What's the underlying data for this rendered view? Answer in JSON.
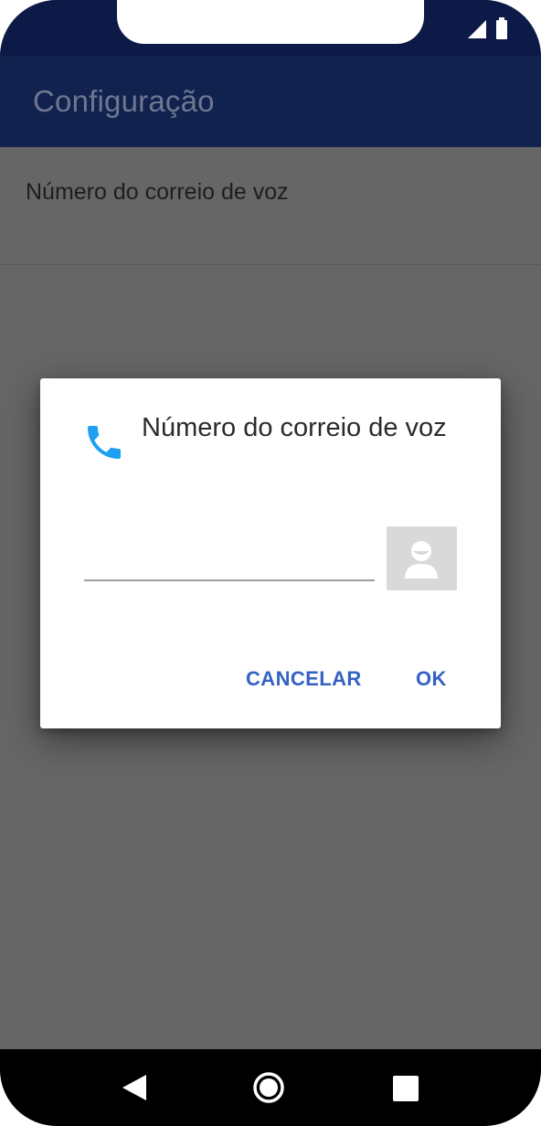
{
  "app_bar": {
    "title": "Configuração"
  },
  "preferences": {
    "items": [
      {
        "label": "Número do correio de voz"
      }
    ]
  },
  "dialog": {
    "title": "Número do correio de voz",
    "icon": "phone-icon",
    "input": {
      "value": "",
      "placeholder": ""
    },
    "contact_picker_icon": "contact-avatar-icon",
    "cancel_label": "CANCELAR",
    "ok_label": "OK"
  },
  "status_bar": {
    "icons": [
      "signal-icon",
      "battery-icon"
    ]
  },
  "nav_bar": {
    "icons": [
      "back-icon",
      "home-icon",
      "recents-icon"
    ]
  },
  "colors": {
    "app_bar": "#11224f",
    "status_bar": "#0d1a47",
    "scrim_background": "#666666",
    "accent": "#3462c4",
    "phone_icon": "#1e9ff2"
  }
}
